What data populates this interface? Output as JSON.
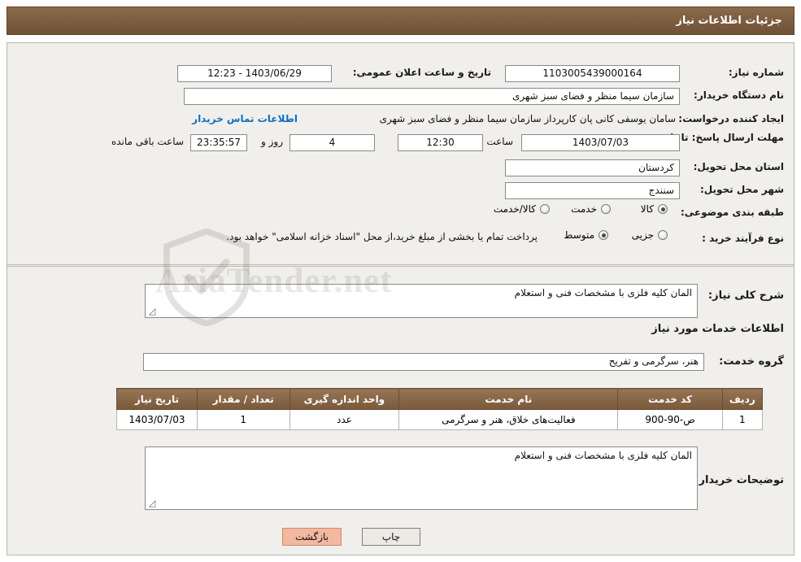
{
  "header": {
    "title": "جزئیات اطلاعات نیاز"
  },
  "fields": {
    "need_number_label": "شماره نیاز:",
    "need_number_value": "1103005439000164",
    "announce_datetime_label": "تاریخ و ساعت اعلان عمومی:",
    "announce_datetime_value": "1403/06/29 - 12:23",
    "buyer_org_label": "نام دستگاه خریدار:",
    "buyer_org_value": "سازمان سیما  منظر و فضای سبز شهری",
    "requester_label": "ایجاد کننده درخواست:",
    "requester_value": "سامان یوسفی کانی پان کارپرداز سازمان سیما  منظر و فضای سبز شهری",
    "buyer_contact_link": "اطلاعات تماس خریدار",
    "deadline_label": "مهلت ارسال پاسخ: تا تاریخ:",
    "deadline_date": "1403/07/03",
    "deadline_hour_label": "ساعت",
    "deadline_hour": "12:30",
    "remaining_days": "4",
    "remaining_days_label": "روز و",
    "remaining_time": "23:35:57",
    "remaining_suffix": "ساعت باقی مانده",
    "province_label": "استان محل تحویل:",
    "province_value": "کردستان",
    "city_label": "شهر محل تحویل:",
    "city_value": "سنندج",
    "category_label": "طبقه بندی موضوعی:",
    "category_options": [
      {
        "label": "کالا",
        "checked": true
      },
      {
        "label": "خدمت",
        "checked": false
      },
      {
        "label": "کالا/خدمت",
        "checked": false
      }
    ],
    "purchase_type_label": "نوع فرآیند خرید :",
    "purchase_options": [
      {
        "label": "جزیی",
        "checked": false
      },
      {
        "label": "متوسط",
        "checked": true
      }
    ],
    "purchase_note": "پرداخت تمام یا بخشی از مبلغ خرید،از محل \"اسناد خزانه اسلامی\" خواهد بود."
  },
  "description": {
    "general_label": "شرح کلی نیاز:",
    "general_value": "المان کلیه فلزی با مشخصات فنی و استعلام",
    "services_section_title": "اطلاعات خدمات مورد نیاز",
    "service_group_label": "گروه خدمت:",
    "service_group_value": "هنر، سرگرمی و تفریح"
  },
  "table": {
    "columns": [
      "ردیف",
      "کد خدمت",
      "نام خدمت",
      "واحد اندازه گیری",
      "تعداد / مقدار",
      "تاریخ نیاز"
    ],
    "rows": [
      {
        "row": "1",
        "code": "ص-90-900",
        "name": "فعالیت‌های خلاق، هنر و سرگرمی",
        "unit": "عدد",
        "qty": "1",
        "date": "1403/07/03"
      }
    ]
  },
  "buyer_notes": {
    "label": "توضیحات خریدار:",
    "value": "المان کلیه فلزی با مشخصات فنی و استعلام"
  },
  "actions": {
    "print": "چاپ",
    "back": "بازگشت"
  },
  "watermark": {
    "text": "AriaTender.net"
  },
  "colors": {
    "header_brown": "#7b5a3f",
    "link_blue": "#0e6fbf",
    "back_button": "#f2b9a0"
  }
}
